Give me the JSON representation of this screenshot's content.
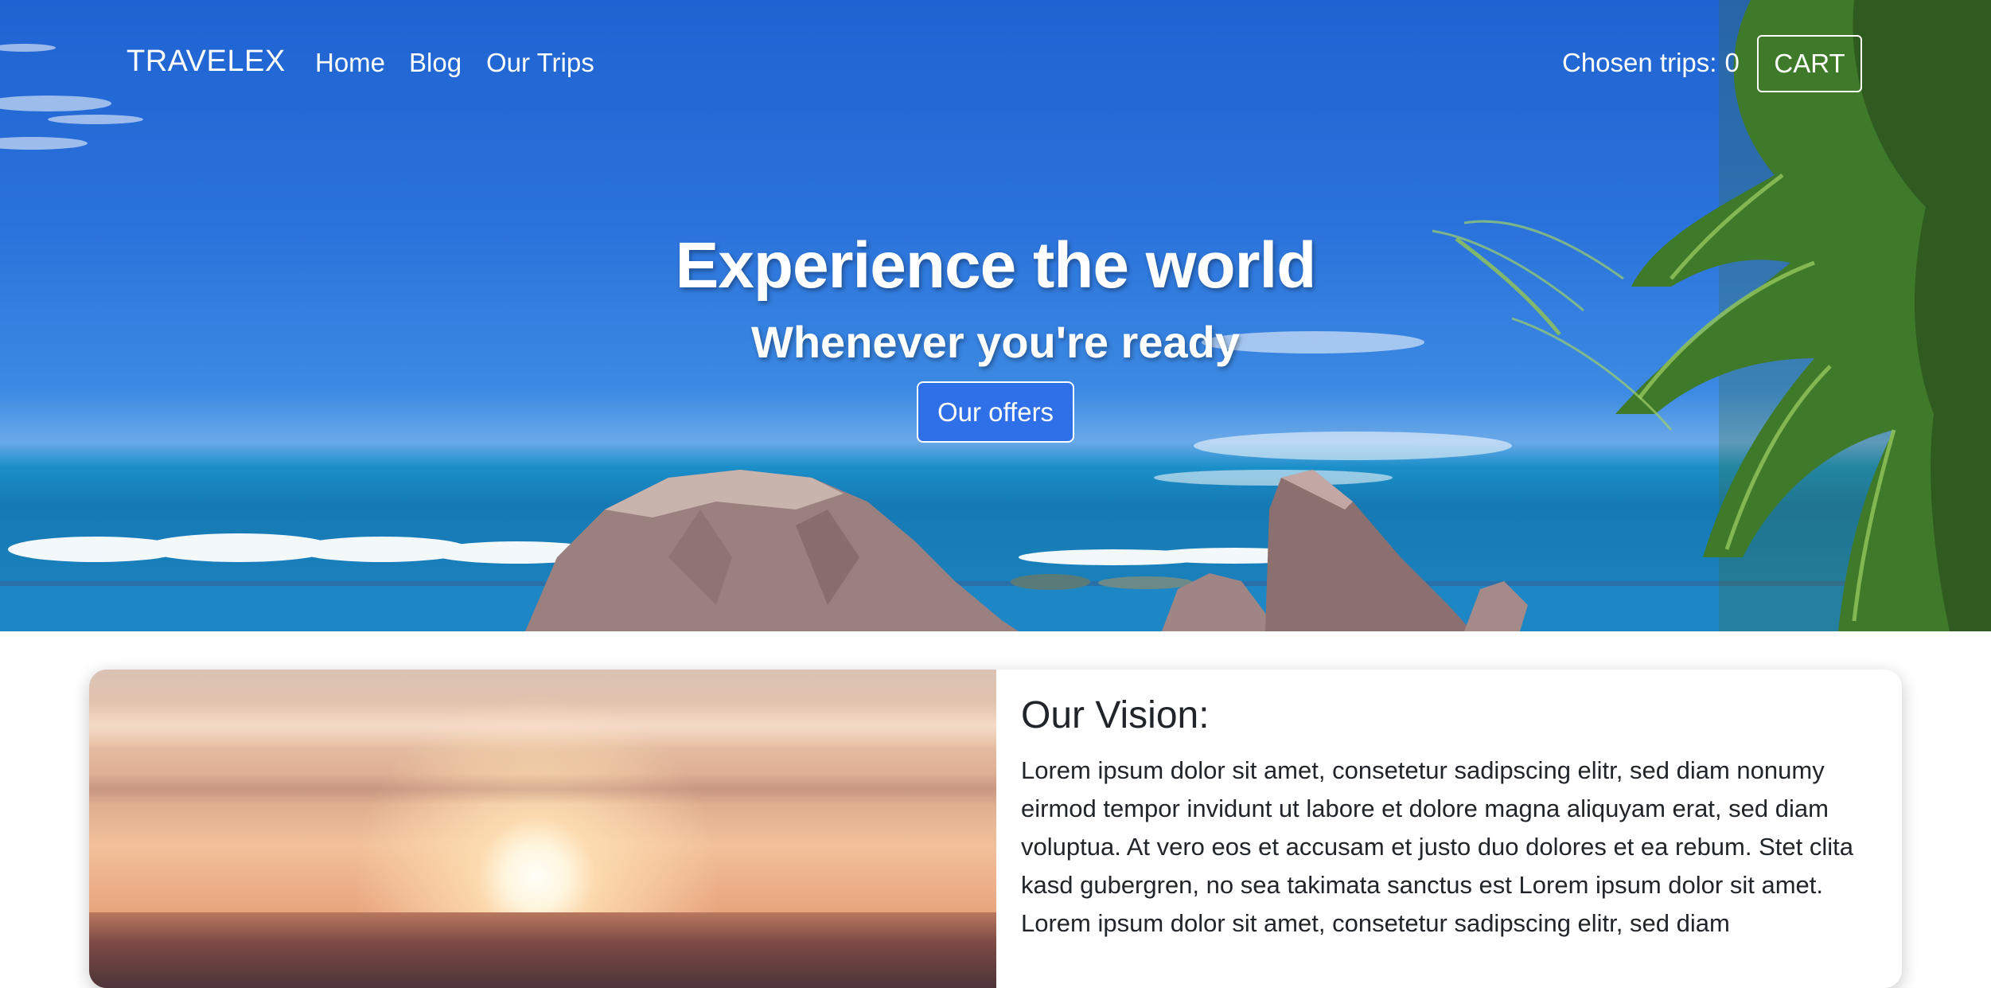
{
  "nav": {
    "brand": "TRAVELEX",
    "links": [
      "Home",
      "Blog",
      "Our Trips"
    ],
    "chosen_label": "Chosen trips:",
    "chosen_count": "0",
    "cart_label": "CART"
  },
  "hero": {
    "title": "Experience the world",
    "subtitle": "Whenever you're ready",
    "cta_label": "Our offers"
  },
  "vision": {
    "title": "Our Vision:",
    "text": "Lorem ipsum dolor sit amet, consetetur sadipscing elitr, sed diam nonumy eirmod tempor invidunt ut labore et dolore magna aliquyam erat, sed diam voluptua. At vero eos et accusam et justo duo dolores et ea rebum. Stet clita kasd gubergren, no sea takimata sanctus est Lorem ipsum dolor sit amet. Lorem ipsum dolor sit amet, consetetur sadipscing elitr, sed diam"
  },
  "colors": {
    "primary_button": "#2f6fe8",
    "text": "#212529",
    "sky": "#2a72db"
  },
  "icons": []
}
